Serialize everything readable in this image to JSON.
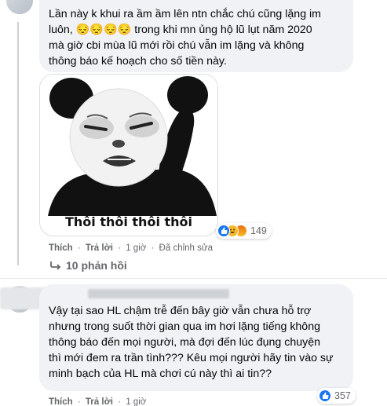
{
  "comment1": {
    "text": "Lần này k khui ra ầm ầm lên ntn chắc chú cũng lặng im\nluôn, 😔😔😔😔 trong khi mn ủng hộ lũ lụt năm 2020\nmà giờ cbi mùa lũ mới rồi chú vẫn im lặng và không\nthông báo kế hoạch cho số tiền này.",
    "sticker_caption": "Thôi thôi thôi thôi",
    "reaction_count": "149",
    "actions": {
      "like": "Thích",
      "reply": "Trả lời",
      "time": "1 giờ",
      "edited": "Đã chỉnh sửa"
    },
    "replies_label": "10 phản hồi"
  },
  "comment2": {
    "text": "Vậy tại sao HL chậm trễ đến bây giờ vẫn chưa hỗ trợ\nnhưng trong suốt thời gian qua im hơi lặng tiếng không\nthông báo đến mọi người, mà đợi đến lúc đụng chuyện\nthì mới đem ra trần tình??? Kêu mọi người hãy tin vào sự\nminh bạch của HL mà chơi cú này thì ai tin??",
    "reaction_count": "357",
    "actions": {
      "like": "Thích",
      "reply": "Trả lời",
      "time": "1 giờ"
    }
  },
  "colors": {
    "bubble": "#f0f2f5",
    "meta": "#65676b",
    "like_blue": "#1877f2",
    "haha_yellow": "#f7b928",
    "angry_red": "#e9710f"
  },
  "icons": {
    "reply_arrow": "reply-arrow-icon",
    "like": "like-reaction-icon",
    "haha": "haha-reaction-icon",
    "angry": "angry-reaction-icon"
  }
}
